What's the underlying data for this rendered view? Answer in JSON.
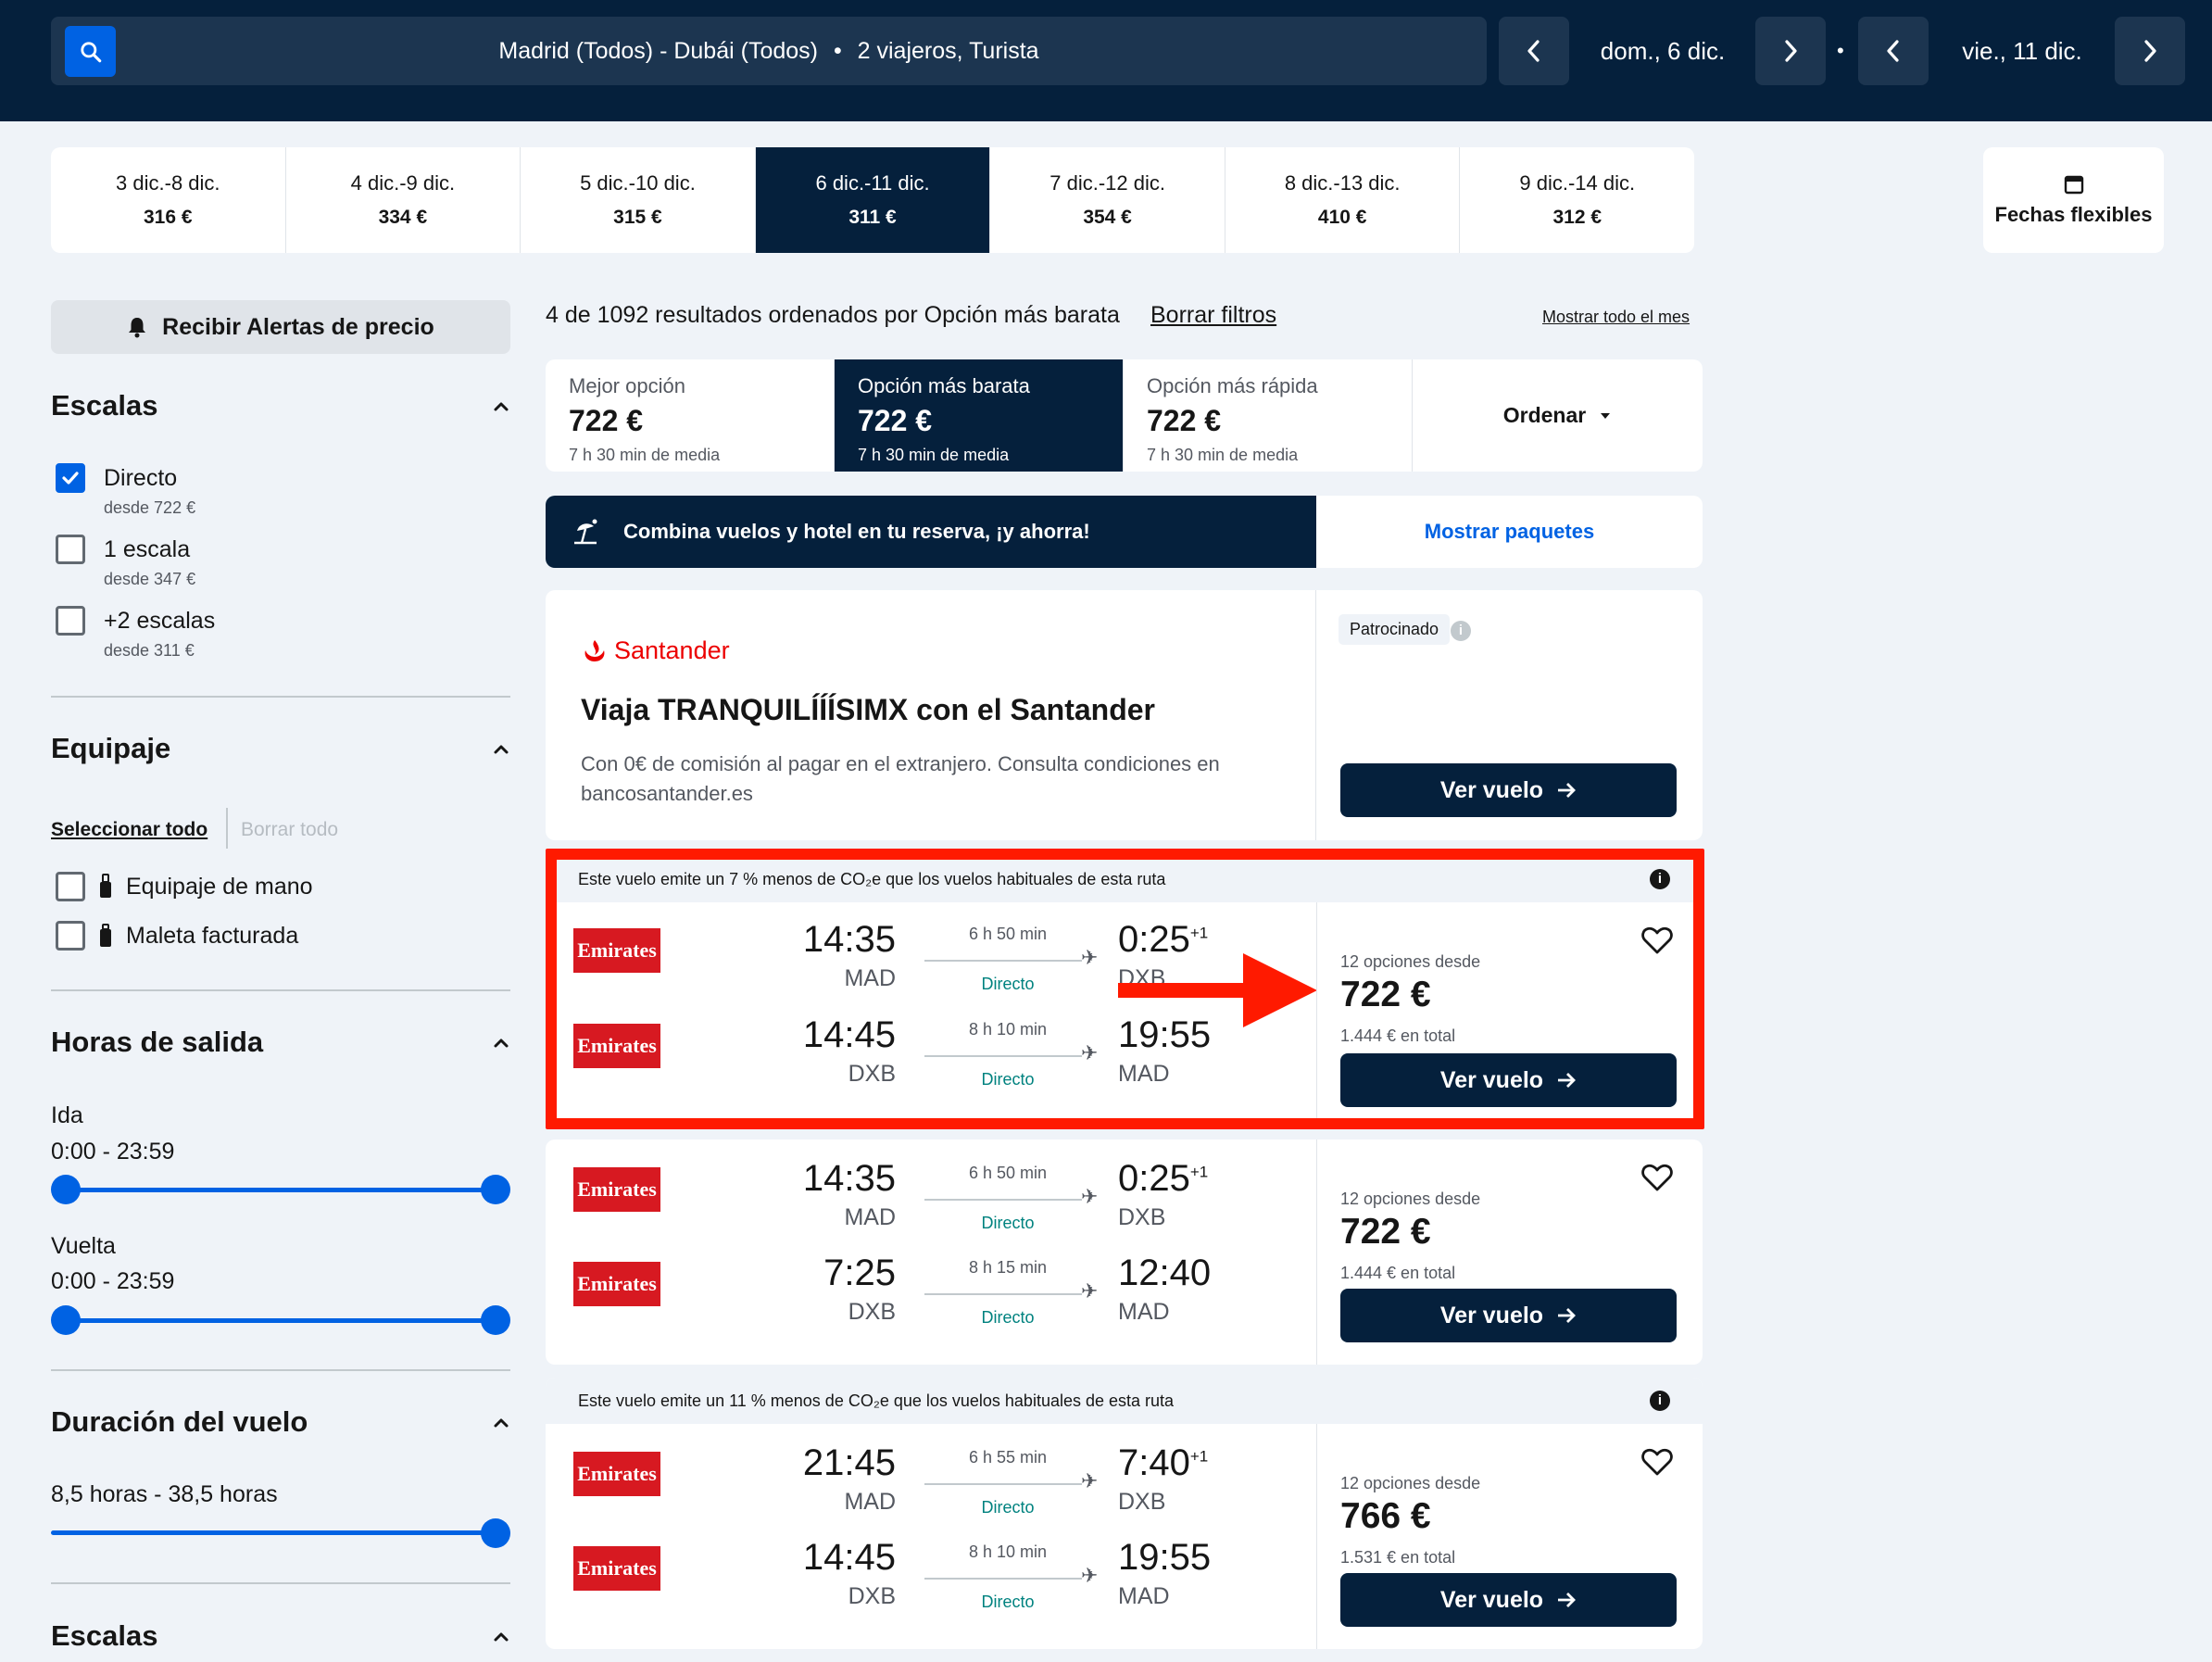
{
  "search": {
    "route": "Madrid (Todos) - Dubái (Todos)",
    "separator": "•",
    "travellers": "2 viajeros, Turista",
    "depart_date": "dom., 6 dic.",
    "return_date": "vie., 11 dic."
  },
  "date_strip": [
    {
      "range": "3 dic.-8 dic.",
      "price": "316 €"
    },
    {
      "range": "4 dic.-9 dic.",
      "price": "334 €"
    },
    {
      "range": "5 dic.-10 dic.",
      "price": "315 €"
    },
    {
      "range": "6 dic.-11 dic.",
      "price": "311 €"
    },
    {
      "range": "7 dic.-12 dic.",
      "price": "354 €"
    },
    {
      "range": "8 dic.-13 dic.",
      "price": "410 €"
    },
    {
      "range": "9 dic.-14 dic.",
      "price": "312 €"
    }
  ],
  "flex_dates_label": "Fechas flexibles",
  "sidebar": {
    "alert_label": "Recibir Alertas de precio",
    "stops_title": "Escalas",
    "stops": [
      {
        "label": "Directo",
        "from": "desde 722 €",
        "checked": true
      },
      {
        "label": "1 escala",
        "from": "desde 347 €",
        "checked": false
      },
      {
        "label": "+2 escalas",
        "from": "desde 311 €",
        "checked": false
      }
    ],
    "baggage_title": "Equipaje",
    "select_all": "Seleccionar todo",
    "clear_all": "Borrar todo",
    "baggage": [
      {
        "label": "Equipaje de mano"
      },
      {
        "label": "Maleta facturada"
      }
    ],
    "times_title": "Horas de salida",
    "outbound_label": "Ida",
    "outbound_range": "0:00 - 23:59",
    "return_label": "Vuelta",
    "return_range": "0:00 - 23:59",
    "duration_title": "Duración del vuelo",
    "duration_range": "8,5 horas - 38,5 horas",
    "stops2_title": "Escalas"
  },
  "results": {
    "count_text": "4 de 1092 resultados ordenados por Opción más barata",
    "clear_filters": "Borrar filtros",
    "show_month": "Mostrar todo el mes"
  },
  "sort_tabs": [
    {
      "title": "Mejor opción",
      "price": "722 €",
      "sub": "7 h 30 min de media"
    },
    {
      "title": "Opción más barata",
      "price": "722 €",
      "sub": "7 h 30 min de media"
    },
    {
      "title": "Opción más rápida",
      "price": "722 €",
      "sub": "7 h 30 min de media"
    }
  ],
  "sort_dropdown": "Ordenar",
  "combo": {
    "text": "Combina vuelos y hotel en tu reserva, ¡y ahorra!",
    "link": "Mostrar paquetes"
  },
  "ad": {
    "brand": "Santander",
    "title": "Viaja TRANQUILÍÍÍSIMX con el Santander",
    "body": "Con 0€ de comisión al pagar en el extranjero. Consulta condiciones en bancosantander.es",
    "sponsored": "Patrocinado",
    "button": "Ver vuelo"
  },
  "flights": [
    {
      "co2": "Este vuelo emite un 7 % menos de CO₂e que los vuelos habituales de esta ruta",
      "legs": [
        {
          "airline": "Emirates",
          "dep_time": "14:35",
          "dep_code": "MAD",
          "duration": "6 h 50 min",
          "stops": "Directo",
          "arr_time": "0:25",
          "arr_plus": "+1",
          "arr_code": "DXB"
        },
        {
          "airline": "Emirates",
          "dep_time": "14:45",
          "dep_code": "DXB",
          "duration": "8 h 10 min",
          "stops": "Directo",
          "arr_time": "19:55",
          "arr_plus": "",
          "arr_code": "MAD"
        }
      ],
      "options": "12 opciones desde",
      "price": "722 €",
      "total": "1.444 € en total",
      "button": "Ver vuelo"
    },
    {
      "co2": "",
      "legs": [
        {
          "airline": "Emirates",
          "dep_time": "14:35",
          "dep_code": "MAD",
          "duration": "6 h 50 min",
          "stops": "Directo",
          "arr_time": "0:25",
          "arr_plus": "+1",
          "arr_code": "DXB"
        },
        {
          "airline": "Emirates",
          "dep_time": "7:25",
          "dep_code": "DXB",
          "duration": "8 h 15 min",
          "stops": "Directo",
          "arr_time": "12:40",
          "arr_plus": "",
          "arr_code": "MAD"
        }
      ],
      "options": "12 opciones desde",
      "price": "722 €",
      "total": "1.444 € en total",
      "button": "Ver vuelo"
    },
    {
      "co2": "Este vuelo emite un 11 % menos de CO₂e que los vuelos habituales de esta ruta",
      "legs": [
        {
          "airline": "Emirates",
          "dep_time": "21:45",
          "dep_code": "MAD",
          "duration": "6 h 55 min",
          "stops": "Directo",
          "arr_time": "7:40",
          "arr_plus": "+1",
          "arr_code": "DXB"
        },
        {
          "airline": "Emirates",
          "dep_time": "14:45",
          "dep_code": "DXB",
          "duration": "8 h 10 min",
          "stops": "Directo",
          "arr_time": "19:55",
          "arr_plus": "",
          "arr_code": "MAD"
        }
      ],
      "options": "12 opciones desde",
      "price": "766 €",
      "total": "1.531 € en total",
      "button": "Ver vuelo"
    }
  ],
  "colors": {
    "navy": "#05203c",
    "accent_blue": "#0062e3",
    "highlight_red": "#ff1a00",
    "emirates_red": "#d71921",
    "santander_red": "#ec0000"
  }
}
